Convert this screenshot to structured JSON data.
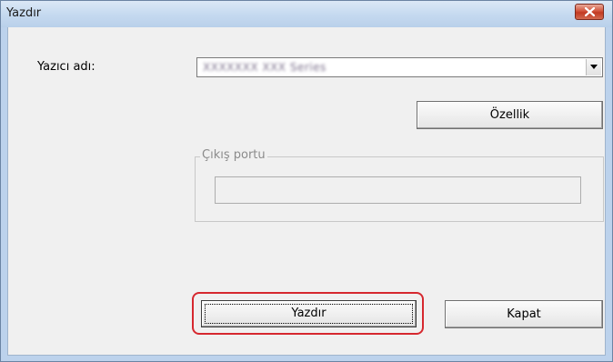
{
  "window": {
    "title": "Yazdır",
    "close_icon": "close-icon",
    "accent_close_color": "#c83b23"
  },
  "printer": {
    "label": "Yazıcı adı:",
    "selected_value": "XXXXXXX XXX Series"
  },
  "buttons": {
    "properties": "Özellik",
    "print": "Yazdır",
    "close": "Kapat"
  },
  "output_port": {
    "legend": "Çıkış portu",
    "value": ""
  },
  "highlight_color": "#d6282f"
}
